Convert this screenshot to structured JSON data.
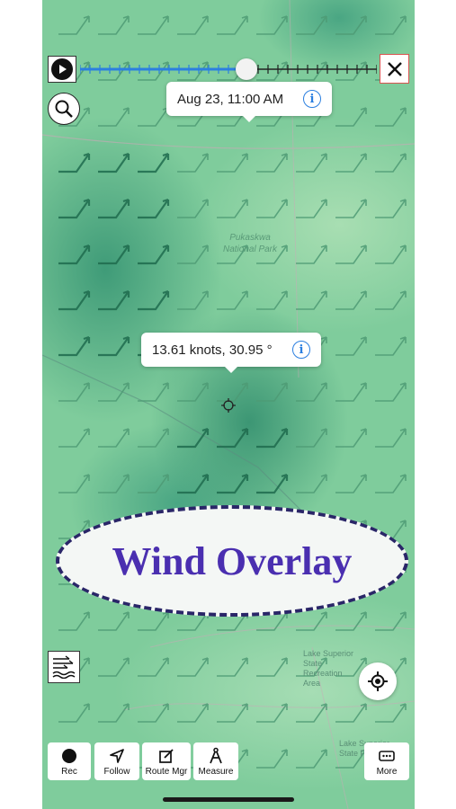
{
  "timeline": {
    "timestamp": "Aug 23, 11:00 AM",
    "position_fraction": 0.56,
    "play_icon": "play-icon",
    "close_icon": "close-icon"
  },
  "wind_popup": {
    "reading": "13.61 knots, 30.95 °"
  },
  "map": {
    "park_label": "Pukaskwa National Park",
    "south_labels": [
      "Lake Superior State Recreation Area",
      "Lake Superior State Forest"
    ]
  },
  "overlay_banner": {
    "text": "Wind Overlay",
    "color": "#4a2fb0"
  },
  "toolbar": {
    "items": [
      {
        "label": "Rec",
        "icon": "record-icon"
      },
      {
        "label": "Follow",
        "icon": "location-arrow-icon"
      },
      {
        "label": "Route Mgr",
        "icon": "edit-route-icon"
      },
      {
        "label": "Measure",
        "icon": "compass-divider-icon"
      },
      {
        "label": "More",
        "icon": "more-icon"
      }
    ]
  },
  "colors": {
    "map_green": "#7fcc9c",
    "timeline_active": "#2b7fe0",
    "info_blue": "#2b7fe0",
    "close_border": "#d9534f"
  }
}
